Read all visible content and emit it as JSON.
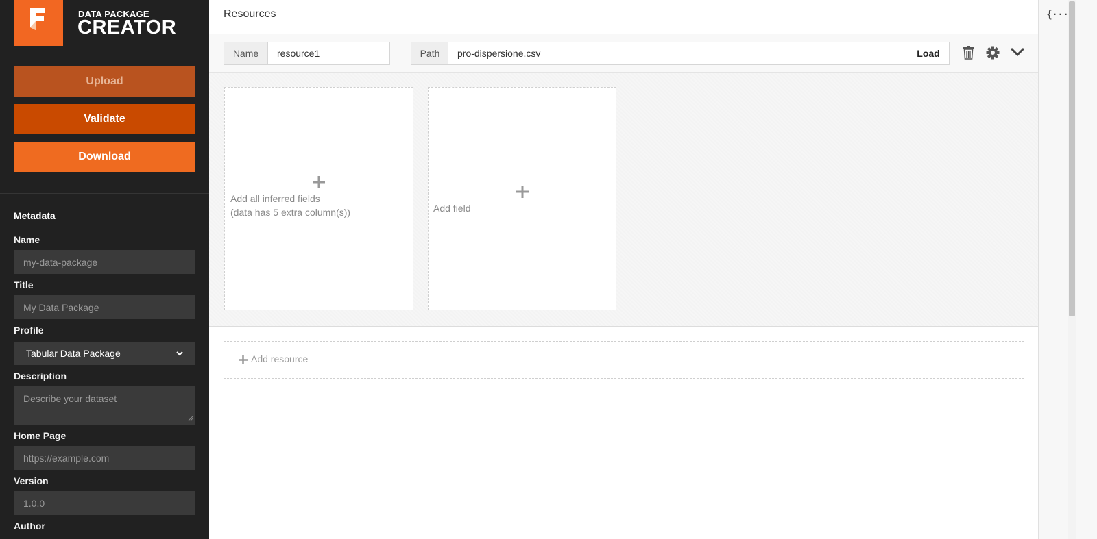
{
  "brand": {
    "small": "DATA PACKAGE",
    "big": "CREATOR",
    "accent": "#f26722"
  },
  "actions": {
    "upload": "Upload",
    "validate": "Validate",
    "download": "Download"
  },
  "metadata": {
    "heading": "Metadata",
    "name_label": "Name",
    "name_placeholder": "my-data-package",
    "title_label": "Title",
    "title_placeholder": "My Data Package",
    "profile_label": "Profile",
    "profile_value": "Tabular Data Package",
    "description_label": "Description",
    "description_placeholder": "Describe your dataset",
    "homepage_label": "Home Page",
    "homepage_placeholder": "https://example.com",
    "version_label": "Version",
    "version_placeholder": "1.0.0",
    "author_label": "Author"
  },
  "resources": {
    "title": "Resources",
    "name_addon": "Name",
    "name_value": "resource1",
    "path_addon": "Path",
    "path_value": "pro-dispersione.csv",
    "load_label": "Load",
    "add_inferred_line1": "Add all inferred fields",
    "add_inferred_line2": "(data has 5 extra column(s))",
    "add_field": "Add field",
    "add_resource": "Add resource"
  },
  "icons": {
    "delete": "trash-icon",
    "settings": "gear-icon",
    "collapse": "chevron-down-icon",
    "json": "json-braces-icon"
  },
  "json_toggle": "{···}"
}
